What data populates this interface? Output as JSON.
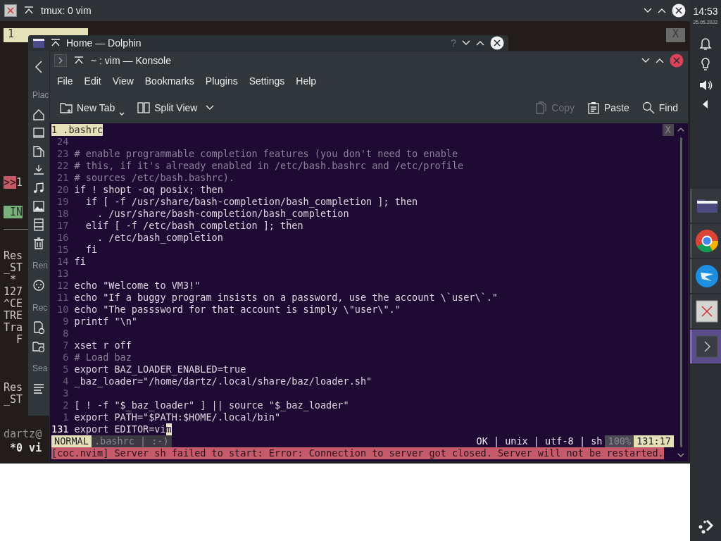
{
  "tmux": {
    "title": "tmux: 0 vim",
    "active": false,
    "tab": "1",
    "close_label": "X",
    "top_lines": [
      {
        "kind": "marker",
        "text": ">>",
        "rest": "1"
      },
      {
        "kind": "mode",
        "text": " IN"
      }
    ],
    "lines": [
      {
        "kind": "plain",
        "text": "Res"
      },
      {
        "kind": "plain",
        "text": "_ST"
      },
      {
        "kind": "plain",
        "text": " *"
      },
      {
        "kind": "plain",
        "text": "127"
      },
      {
        "kind": "plain",
        "text": "^CE"
      },
      {
        "kind": "plain",
        "text": "TRE"
      },
      {
        "kind": "plain",
        "text": "Tra"
      },
      {
        "kind": "plain",
        "text": "  F"
      },
      {
        "kind": "blank"
      },
      {
        "kind": "blank"
      },
      {
        "kind": "blank"
      },
      {
        "kind": "plain",
        "text": "Res"
      },
      {
        "kind": "plain",
        "text": "_ST"
      }
    ],
    "bottom_lines": [
      {
        "kind": "dim",
        "text": "dartz@"
      },
      {
        "kind": "bold",
        "text": " *0 vi"
      }
    ]
  },
  "dolphin": {
    "title": "Home — Dolphin",
    "active": false,
    "help_glyph": "?",
    "sections": [
      {
        "label": "Plac",
        "items": [
          {
            "kind": "home"
          },
          {
            "kind": "window"
          },
          {
            "kind": "documents"
          },
          {
            "kind": "download"
          },
          {
            "kind": "music"
          },
          {
            "kind": "image"
          },
          {
            "kind": "film"
          },
          {
            "kind": "trash"
          }
        ]
      },
      {
        "label": "Ren",
        "items": [
          {
            "kind": "network"
          }
        ]
      },
      {
        "label": "Rec",
        "items": [
          {
            "kind": "recent-doc"
          },
          {
            "kind": "recent-folder"
          }
        ]
      },
      {
        "label": "Sea",
        "items": [
          {
            "kind": "list"
          }
        ]
      }
    ]
  },
  "konsole": {
    "title": "~ : vim — Konsole",
    "active": true,
    "menu": [
      "File",
      "Edit",
      "View",
      "Bookmarks",
      "Plugins",
      "Settings",
      "Help"
    ],
    "toolbar": [
      {
        "kind": "new-tab",
        "label": "New Tab",
        "disabled": false
      },
      {
        "kind": "split",
        "label": "Split View",
        "disabled": false
      },
      {
        "kind": "copy",
        "label": "Copy",
        "disabled": true
      },
      {
        "kind": "paste",
        "label": "Paste",
        "disabled": false
      },
      {
        "kind": "find",
        "label": "Find",
        "disabled": false
      }
    ],
    "vim": {
      "tab": "1 .bashrc",
      "tab_close": "X",
      "lines": [
        {
          "number": "24",
          "kind": "blank"
        },
        {
          "number": "23",
          "kind": "comment",
          "code": "# enable programmable completion features (you don't need to enable"
        },
        {
          "number": "22",
          "kind": "comment",
          "code": "# this, if it's already enabled in /etc/bash.bashrc and /etc/profile"
        },
        {
          "number": "21",
          "kind": "comment",
          "code": "# sources /etc/bash.bashrc)."
        },
        {
          "number": "20",
          "kind": "code",
          "code": "if ! shopt -oq posix; then"
        },
        {
          "number": "19",
          "kind": "code",
          "code": "  if [ -f /usr/share/bash-completion/bash_completion ]; then"
        },
        {
          "number": "18",
          "kind": "code",
          "code": "    . /usr/share/bash-completion/bash_completion"
        },
        {
          "number": "17",
          "kind": "code",
          "code": "  elif [ -f /etc/bash_completion ]; then"
        },
        {
          "number": "16",
          "kind": "code",
          "code": "    . /etc/bash_completion"
        },
        {
          "number": "15",
          "kind": "code",
          "code": "  fi"
        },
        {
          "number": "14",
          "kind": "code",
          "code": "fi"
        },
        {
          "number": "13",
          "kind": "blank"
        },
        {
          "number": "12",
          "kind": "code",
          "code": "echo \"Welcome to VM3!\""
        },
        {
          "number": "11",
          "kind": "code",
          "code": "echo \"If a buggy program insists on a password, use the account \\`user\\`.\""
        },
        {
          "number": "10",
          "kind": "code",
          "code": "echo \"The passsword for that account is simply \\\"user\\\".\""
        },
        {
          "number": "9",
          "kind": "code",
          "code": "printf \"\\n\""
        },
        {
          "number": "8",
          "kind": "blank"
        },
        {
          "number": "7",
          "kind": "code",
          "code": "xset r off"
        },
        {
          "number": "6",
          "kind": "comment",
          "code": "# Load baz"
        },
        {
          "number": "5",
          "kind": "code",
          "code": "export BAZ_LOADER_ENABLED=true"
        },
        {
          "number": "4",
          "kind": "code",
          "code": "_baz_loader=\"/home/dartz/.local/share/baz/loader.sh\""
        },
        {
          "number": "3",
          "kind": "blank"
        },
        {
          "number": "2",
          "kind": "code",
          "code": "[ ! -f \"$_baz_loader\" ] || source \"$_baz_loader\""
        },
        {
          "number": "1",
          "kind": "code",
          "code": "export PATH=\"$PATH:$HOME/.local/bin\""
        },
        {
          "number": "131",
          "kind": "current",
          "code": "export EDITOR=vi",
          "cursor": "m"
        }
      ],
      "status": {
        "mode": "NORMAL",
        "file": ".bashrc | :-)",
        "info": "OK | unix | utf-8 | sh",
        "percent": "100%",
        "position": "131:17"
      },
      "message": "[coc.nvim] Server sh failed to start: Error: Connection to server got closed. Server will not be restarted."
    }
  },
  "panel": {
    "time": "14:53",
    "date": "25.05.2022",
    "tasks": [
      {
        "kind": "folder",
        "selected": false
      },
      {
        "kind": "ring",
        "selected": false
      },
      {
        "kind": "plane",
        "selected": false
      },
      {
        "kind": "cross",
        "selected": false
      },
      {
        "kind": "terminal",
        "selected": true
      }
    ]
  }
}
